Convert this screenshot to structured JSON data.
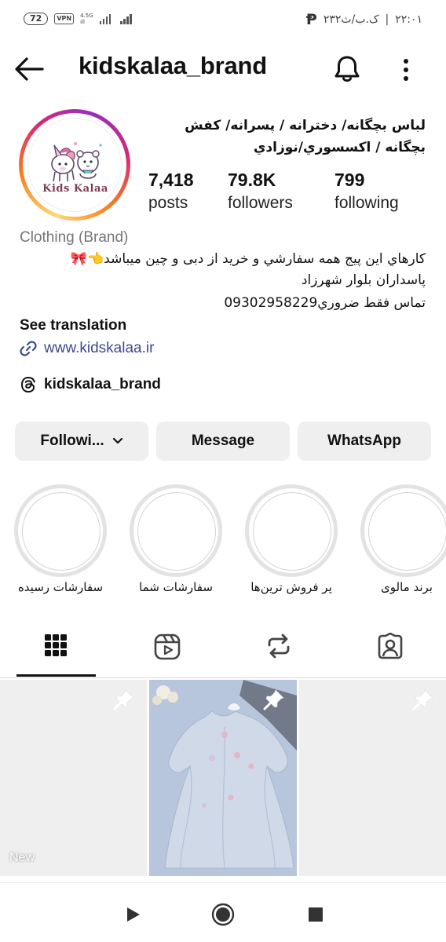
{
  "status_bar": {
    "battery": "72",
    "vpn": "VPN",
    "network_type": "4.5G",
    "network_sub": "ıll",
    "time": "۲۲:۰۱",
    "date": "۲۳۲ک.ب/ث"
  },
  "header": {
    "username": "kidskalaa_brand"
  },
  "profile": {
    "logo_text": "Kids Kalaa",
    "name": "لباس بچگانه/ دخترانه / پسرانه/ کفش بچگانه / اکسسوري/نوزادي",
    "stats": [
      {
        "count": "7,418",
        "label": "posts"
      },
      {
        "count": "79.8K",
        "label": "followers"
      },
      {
        "count": "799",
        "label": "following"
      }
    ],
    "category": "Clothing (Brand)",
    "bio": [
      "کارهاي اين پيج همه سفارشي و خريد از دبى و چين ميباشد👈🎀",
      "پاسداران بلوار شهرزاد",
      "تماس فقط ضروري09302958229"
    ],
    "see_translation": "See translation",
    "link": "www.kidskalaa.ir",
    "threads": "kidskalaa_brand"
  },
  "actions": {
    "following": "Followi...",
    "message": "Message",
    "whatsapp": "WhatsApp"
  },
  "highlights": [
    "سفارشات رسیده",
    "سفارشات شما",
    "پر فروش ترین‌ها",
    "برند مالوی"
  ],
  "tabs": [
    "grid",
    "reels",
    "reposts",
    "tagged"
  ],
  "posts": [
    {
      "label": "New"
    }
  ],
  "colors": {
    "link": "#3c4a8e",
    "button_bg": "#efefef",
    "muted": "#767676"
  }
}
